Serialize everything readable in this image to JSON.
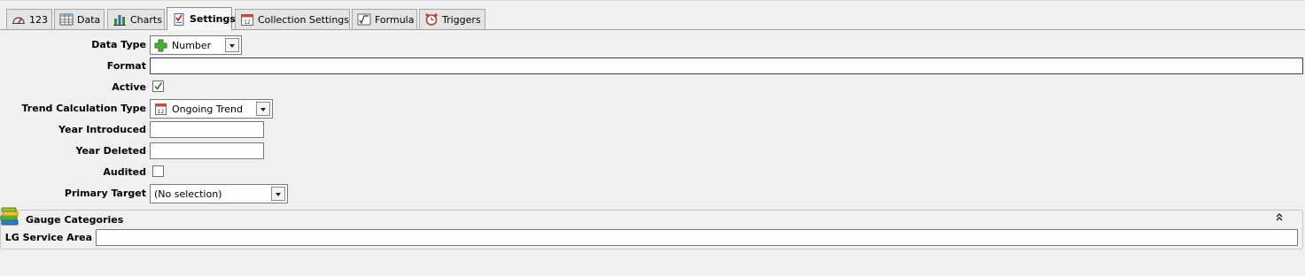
{
  "tabs": [
    {
      "label": "123",
      "icon": "gauge-icon"
    },
    {
      "label": "Data",
      "icon": "table-grid-icon"
    },
    {
      "label": "Charts",
      "icon": "bar-chart-icon"
    },
    {
      "label": "Settings",
      "icon": "checklist-icon"
    },
    {
      "label": "Collection Settings",
      "icon": "calendar-icon"
    },
    {
      "label": "Formula",
      "icon": "sqrt-formula-icon"
    },
    {
      "label": "Triggers",
      "icon": "alarm-clock-icon"
    }
  ],
  "active_tab": "Settings",
  "form": {
    "data_type": {
      "label": "Data Type",
      "value": "Number",
      "icon": "green-plus-icon"
    },
    "format": {
      "label": "Format",
      "value": ""
    },
    "active": {
      "label": "Active",
      "checked": true
    },
    "trend_calc": {
      "label": "Trend Calculation Type",
      "value": "Ongoing Trend",
      "icon": "calendar-icon"
    },
    "year_introduced": {
      "label": "Year Introduced",
      "value": ""
    },
    "year_deleted": {
      "label": "Year Deleted",
      "value": ""
    },
    "audited": {
      "label": "Audited",
      "checked": false
    },
    "primary_target": {
      "label": "Primary Target",
      "value": "(No selection)"
    }
  },
  "gauge_categories": {
    "title": "Gauge Categories",
    "icon": "books-stack-icon",
    "collapse_icon": "double-chevron-up-icon",
    "fields": [
      {
        "label": "LG Service Area",
        "value": ""
      }
    ]
  }
}
